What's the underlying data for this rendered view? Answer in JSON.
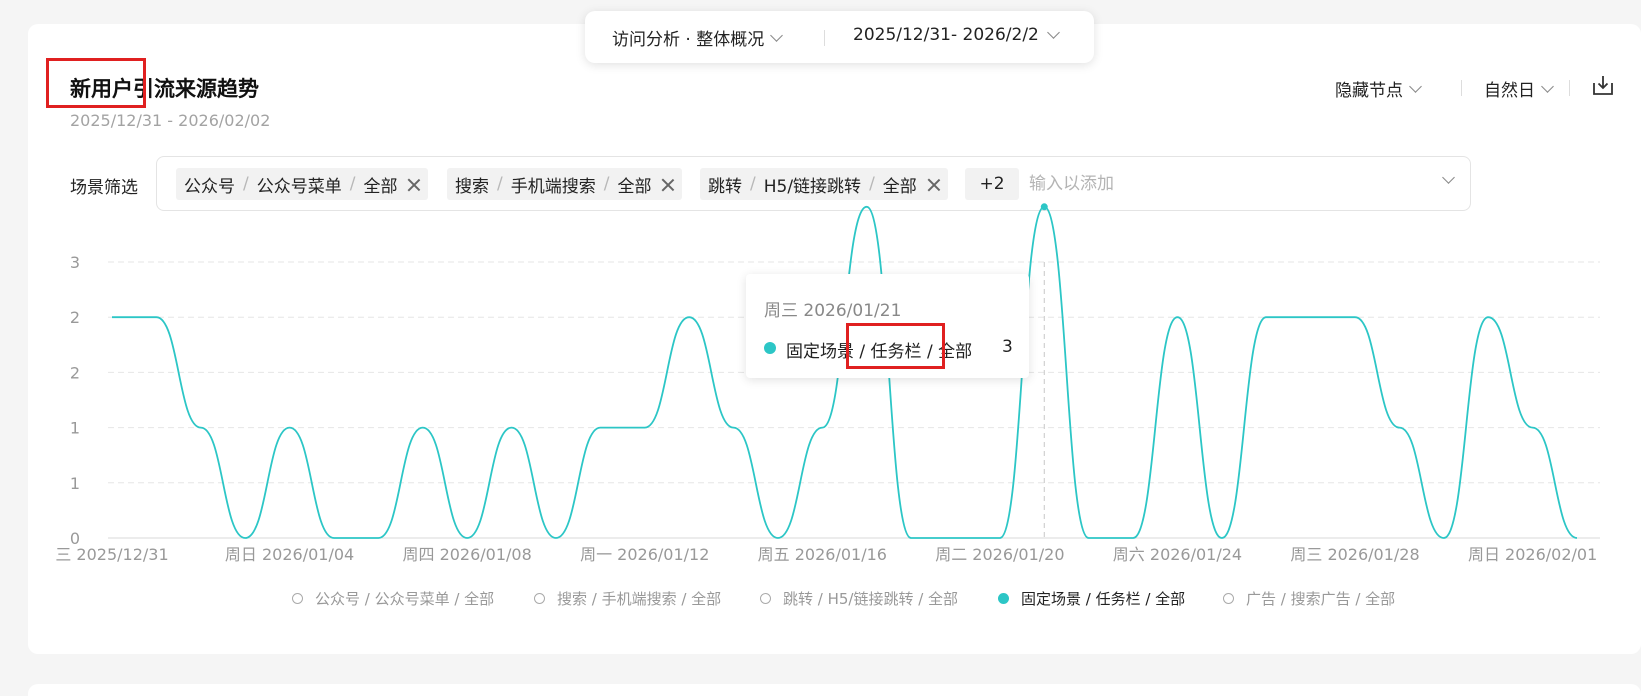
{
  "topbar": {
    "view": "访问分析 · 整体概况",
    "date_range": "2025/12/31- 2026/2/2"
  },
  "card": {
    "title": "新用户引流来源趋势",
    "date": "2025/12/31 - 2026/02/02",
    "hide_nodes": "隐藏节点",
    "granularity": "自然日"
  },
  "filter": {
    "label": "场景筛选",
    "chips": [
      [
        "公众号",
        "公众号菜单",
        "全部"
      ],
      [
        "搜索",
        "手机端搜索",
        "全部"
      ],
      [
        "跳转",
        "H5/链接跳转",
        "全部"
      ]
    ],
    "more": "+2",
    "placeholder": "输入以添加"
  },
  "tooltip": {
    "date": "周三 2026/01/21",
    "series": "固定场景 / 任务栏 / 全部",
    "value": "3"
  },
  "legend": [
    {
      "label": "公众号 / 公众号菜单 / 全部",
      "active": false
    },
    {
      "label": "搜索 / 手机端搜索 / 全部",
      "active": false
    },
    {
      "label": "跳转 / H5/链接跳转 / 全部",
      "active": false
    },
    {
      "label": "固定场景 / 任务栏 / 全部",
      "active": true
    },
    {
      "label": "广告 / 搜索广告 / 全部",
      "active": false
    }
  ],
  "colors": {
    "accent": "#2cc6c6",
    "highlight": "#e02020"
  },
  "chart_data": {
    "type": "line",
    "y_tick_labels": [
      "0",
      "1",
      "1",
      "2",
      "2",
      "3"
    ],
    "y_tick_values": [
      0,
      0.5,
      1,
      1.5,
      2,
      2.5
    ],
    "ylim": [
      0,
      2.5
    ],
    "x_tick_labels": [
      "三 2025/12/31",
      "周日 2026/01/04",
      "周四 2026/01/08",
      "周一 2026/01/12",
      "周五 2026/01/16",
      "周二 2026/01/20",
      "周六 2026/01/24",
      "周三 2026/01/28",
      "周日 2026/02/01"
    ],
    "x": [
      "2025/12/31",
      "2026/01/01",
      "2026/01/02",
      "2026/01/03",
      "2026/01/04",
      "2026/01/05",
      "2026/01/06",
      "2026/01/07",
      "2026/01/08",
      "2026/01/09",
      "2026/01/10",
      "2026/01/11",
      "2026/01/12",
      "2026/01/13",
      "2026/01/14",
      "2026/01/15",
      "2026/01/16",
      "2026/01/17",
      "2026/01/18",
      "2026/01/19",
      "2026/01/20",
      "2026/01/21",
      "2026/01/22",
      "2026/01/23",
      "2026/01/24",
      "2026/01/25",
      "2026/01/26",
      "2026/01/27",
      "2026/01/28",
      "2026/01/29",
      "2026/01/30",
      "2026/01/31",
      "2026/02/01",
      "2026/02/02"
    ],
    "series": [
      {
        "name": "固定场景 / 任务栏 / 全部",
        "values": [
          2,
          2,
          1,
          0,
          1,
          0,
          0,
          1,
          0,
          1,
          0,
          1,
          1,
          2,
          1,
          0,
          1,
          3,
          0,
          0,
          0,
          3,
          0,
          0,
          2,
          0,
          2,
          2,
          2,
          1,
          0,
          2,
          1,
          0
        ]
      }
    ],
    "highlight_index": 21,
    "grid": true,
    "legend_position": "bottom"
  }
}
